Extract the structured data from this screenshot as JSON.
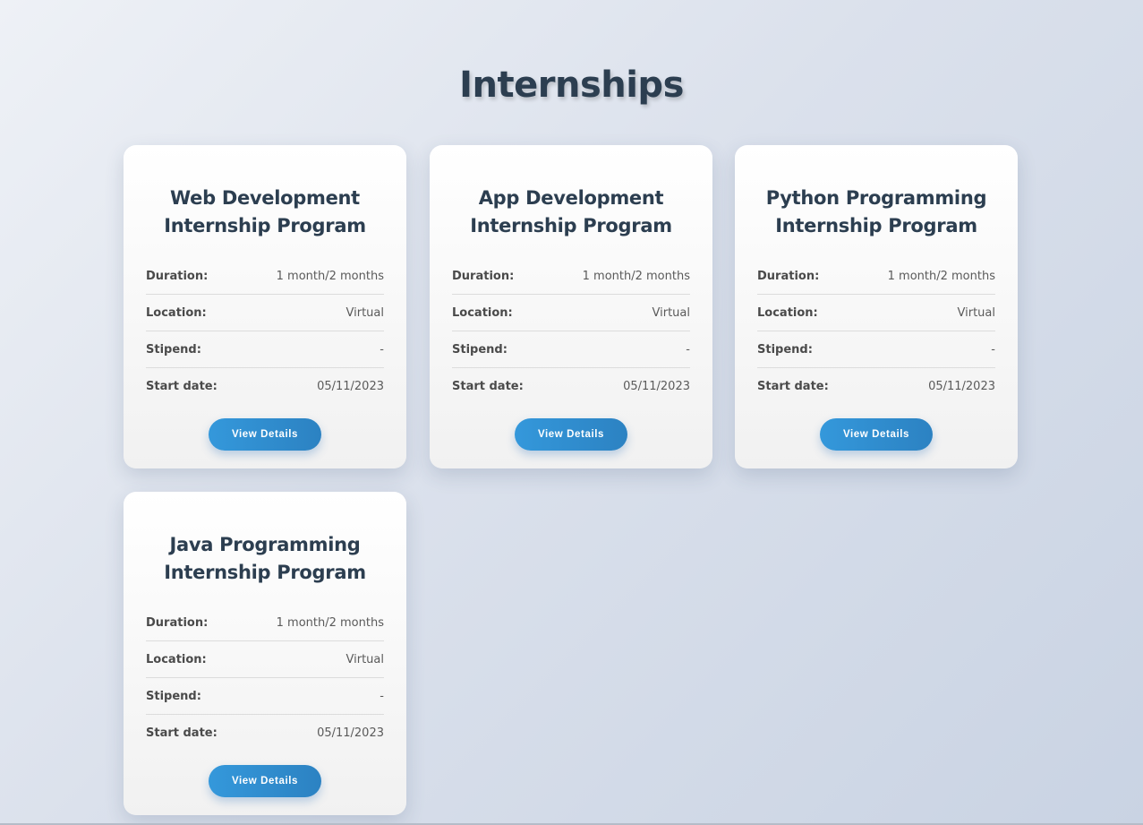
{
  "page": {
    "title": "Internships"
  },
  "labels": {
    "duration": "Duration:",
    "location": "Location:",
    "stipend": "Stipend:",
    "start_date": "Start date:",
    "button": "View Details"
  },
  "cards": [
    {
      "title": "Web Development Internship Program",
      "duration": "1 month/2 months",
      "location": "Virtual",
      "stipend": "-",
      "start_date": "05/11/2023"
    },
    {
      "title": "App Development Internship Program",
      "duration": "1 month/2 months",
      "location": "Virtual",
      "stipend": "-",
      "start_date": "05/11/2023"
    },
    {
      "title": "Python Programming Internship Program",
      "duration": "1 month/2 months",
      "location": "Virtual",
      "stipend": "-",
      "start_date": "05/11/2023"
    },
    {
      "title": "Java Programming Internship Program",
      "duration": "1 month/2 months",
      "location": "Virtual",
      "stipend": "-",
      "start_date": "05/11/2023"
    }
  ],
  "colors": {
    "heading": "#2c3e50",
    "button_start": "#3498db",
    "button_end": "#2c82c2"
  }
}
